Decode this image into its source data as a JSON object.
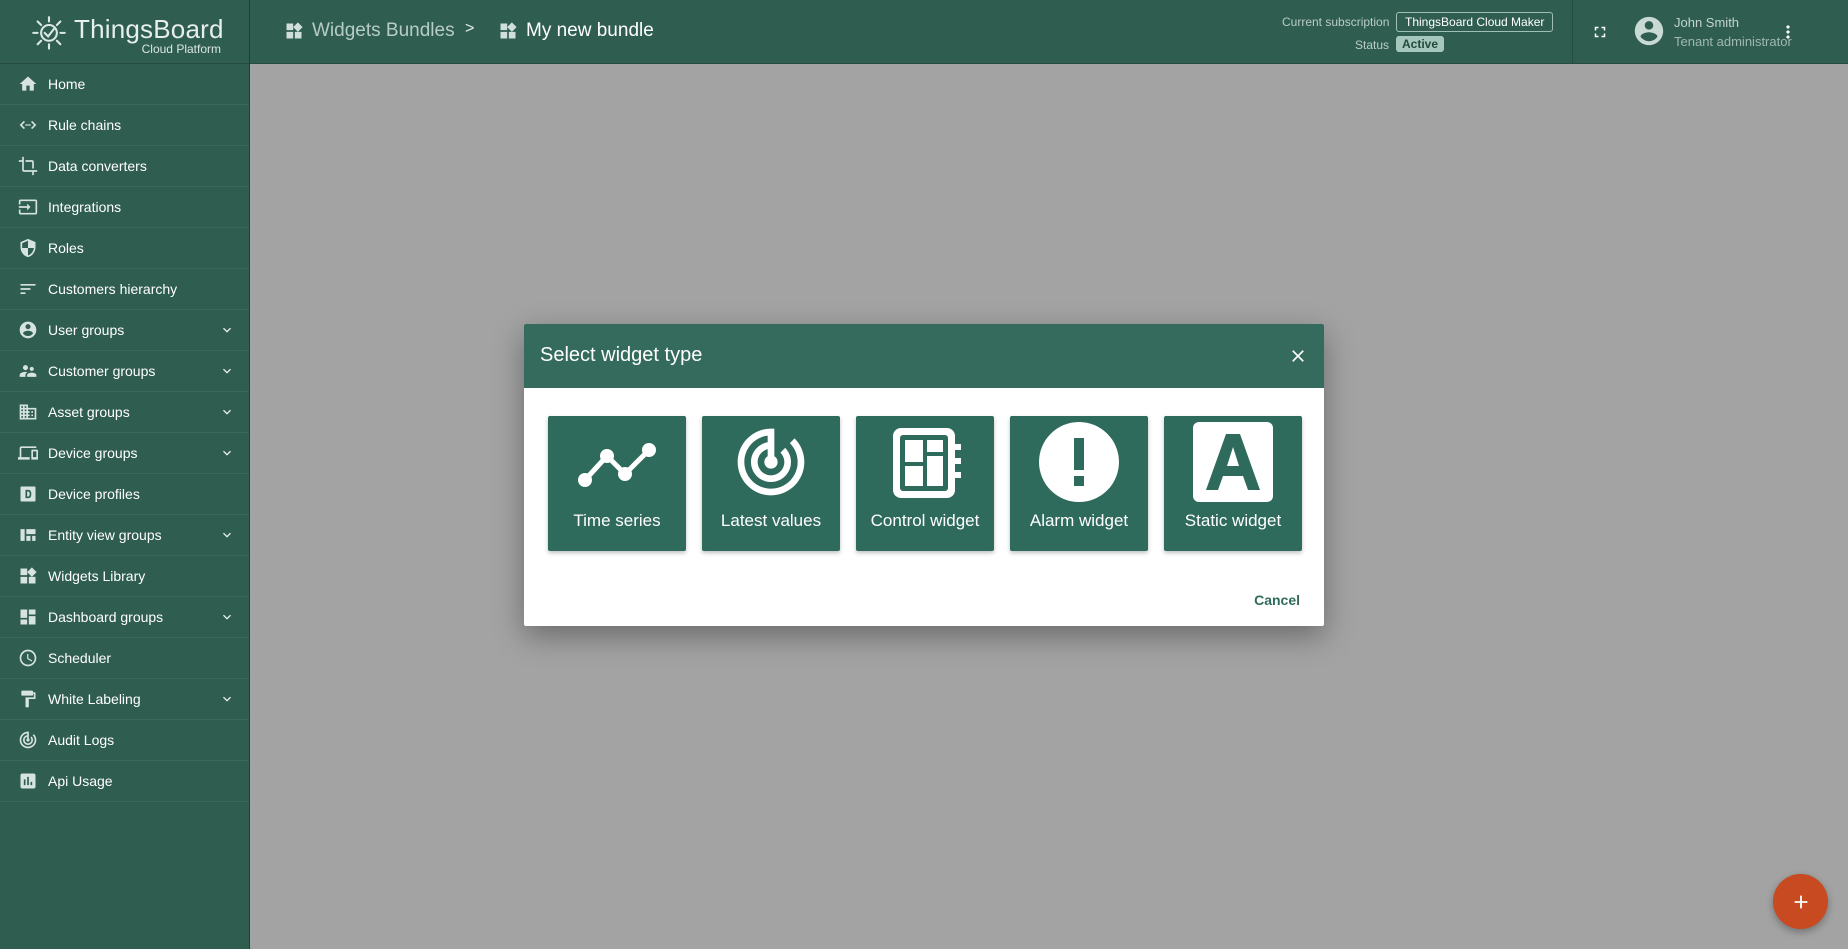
{
  "app": {
    "name": "ThingsBoard",
    "subtitle": "Cloud Platform"
  },
  "sidebar": {
    "items": [
      {
        "label": "Home",
        "icon": "home-icon",
        "expandable": false
      },
      {
        "label": "Rule chains",
        "icon": "rule-chains-icon",
        "expandable": false
      },
      {
        "label": "Data converters",
        "icon": "crop-icon",
        "expandable": false
      },
      {
        "label": "Integrations",
        "icon": "input-icon",
        "expandable": false
      },
      {
        "label": "Roles",
        "icon": "shield-icon",
        "expandable": false
      },
      {
        "label": "Customers hierarchy",
        "icon": "sort-icon",
        "expandable": false
      },
      {
        "label": "User groups",
        "icon": "account-circle-icon",
        "expandable": true
      },
      {
        "label": "Customer groups",
        "icon": "supervisor-icon",
        "expandable": true
      },
      {
        "label": "Asset groups",
        "icon": "domain-icon",
        "expandable": true
      },
      {
        "label": "Device groups",
        "icon": "devices-icon",
        "expandable": true
      },
      {
        "label": "Device profiles",
        "icon": "device-profile-icon",
        "expandable": false
      },
      {
        "label": "Entity view groups",
        "icon": "view-quilt-icon",
        "expandable": true
      },
      {
        "label": "Widgets Library",
        "icon": "widgets-icon",
        "expandable": false
      },
      {
        "label": "Dashboard groups",
        "icon": "dashboard-icon",
        "expandable": true
      },
      {
        "label": "Scheduler",
        "icon": "schedule-icon",
        "expandable": false
      },
      {
        "label": "White Labeling",
        "icon": "format-paint-icon",
        "expandable": true
      },
      {
        "label": "Audit Logs",
        "icon": "track-changes-icon",
        "expandable": false
      },
      {
        "label": "Api Usage",
        "icon": "insert-chart-icon",
        "expandable": false
      }
    ]
  },
  "header": {
    "breadcrumb": [
      {
        "label": "Widgets Bundles",
        "icon": "widgets-icon"
      },
      {
        "label": "My new bundle",
        "icon": "widgets-icon"
      }
    ],
    "separator": ">",
    "subscription_label": "Current subscription",
    "subscription_value": "ThingsBoard Cloud Maker",
    "status_label": "Status",
    "status_value": "Active",
    "user_name": "John Smith",
    "user_role": "Tenant administrator"
  },
  "dialog": {
    "title": "Select widget type",
    "cancel_label": "Cancel",
    "tiles": [
      {
        "label": "Time series",
        "icon": "timeline-icon"
      },
      {
        "label": "Latest values",
        "icon": "track-changes-icon"
      },
      {
        "label": "Control widget",
        "icon": "settings-remote-icon"
      },
      {
        "label": "Alarm widget",
        "icon": "error-icon"
      },
      {
        "label": "Static widget",
        "icon": "font-download-icon"
      }
    ]
  },
  "colors": {
    "primary": "#2f5d50",
    "tile": "#2f6b5c",
    "accent": "#c74a21",
    "overlay": "#a3a3a3"
  }
}
